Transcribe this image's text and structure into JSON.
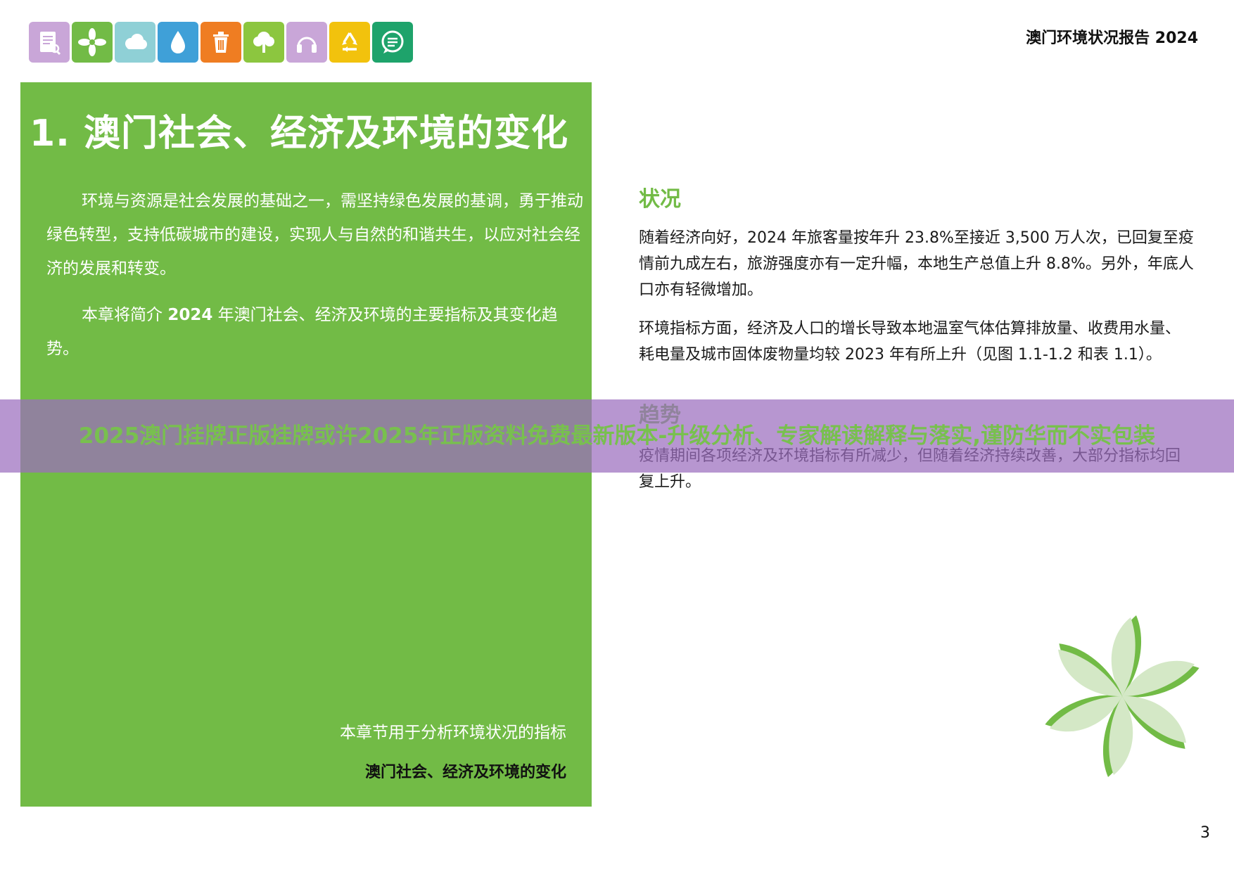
{
  "header": {
    "report_title": "澳门环境状况报告 2024"
  },
  "icons": [
    {
      "name": "document-icon",
      "color": "#c9a6d8"
    },
    {
      "name": "pinwheel-icon",
      "color": "#72bb46"
    },
    {
      "name": "cloud-icon",
      "color": "#8fd0d6"
    },
    {
      "name": "water-drop-icon",
      "color": "#3fa0d8"
    },
    {
      "name": "trash-can-icon",
      "color": "#ef7d22"
    },
    {
      "name": "tree-icon",
      "color": "#8cc63f"
    },
    {
      "name": "headphones-icon",
      "color": "#c9a6d8"
    },
    {
      "name": "recycle-icon",
      "color": "#f2c20d"
    },
    {
      "name": "speech-bubble-icon",
      "color": "#1ea36b"
    }
  ],
  "panel": {
    "chapter_title": "1. 澳门社会、经济及环境的变化",
    "intro_p1": "环境与资源是社会发展的基础之一，需坚持绿色发展的基调，勇于推动绿色转型，支持低碳城市的建设，实现人与自然的和谐共生，以应对社会经济的发展和转变。",
    "intro_p2_a": "本章将简介 ",
    "intro_p2_year": "2024",
    "intro_p2_b": " 年澳门社会、经济及环境的主要指标及其变化趋势。",
    "footer_subtitle": "本章节用于分析环境状况的指标",
    "footer_caption": "澳门社会、经济及环境的变化"
  },
  "status": {
    "heading": "状况",
    "p1": "随着经济向好，2024 年旅客量按年升 23.8%至接近 3,500 万人次，已回复至疫情前九成左右，旅游强度亦有一定升幅，本地生产总值上升 8.8%。另外，年底人口亦有轻微增加。",
    "p2": "环境指标方面，经济及人口的增长导致本地温室气体估算排放量、收费用水量、耗电量及城市固体废物量均较 2023 年有所上升（见图 1.1-1.2 和表 1.1）。"
  },
  "trend": {
    "heading": "趋势",
    "p1": "疫情期间各项经济及环境指标有所减少，但随着经济持续改善，大部分指标均回复上升。"
  },
  "banner": {
    "text": "2025澳门挂牌正版挂牌或许2025年正版资料免费最新版本-升级分析、专家解读解释与落实,谨防华而不实包装",
    "bg_color": "#9b6ebe",
    "text_color": "#78c04e"
  },
  "page_number": "3",
  "colors": {
    "panel_green": "#72bb46",
    "heading_green": "#72bb46",
    "flower_light": "#d4e8c6",
    "flower_dark": "#72bb46"
  }
}
